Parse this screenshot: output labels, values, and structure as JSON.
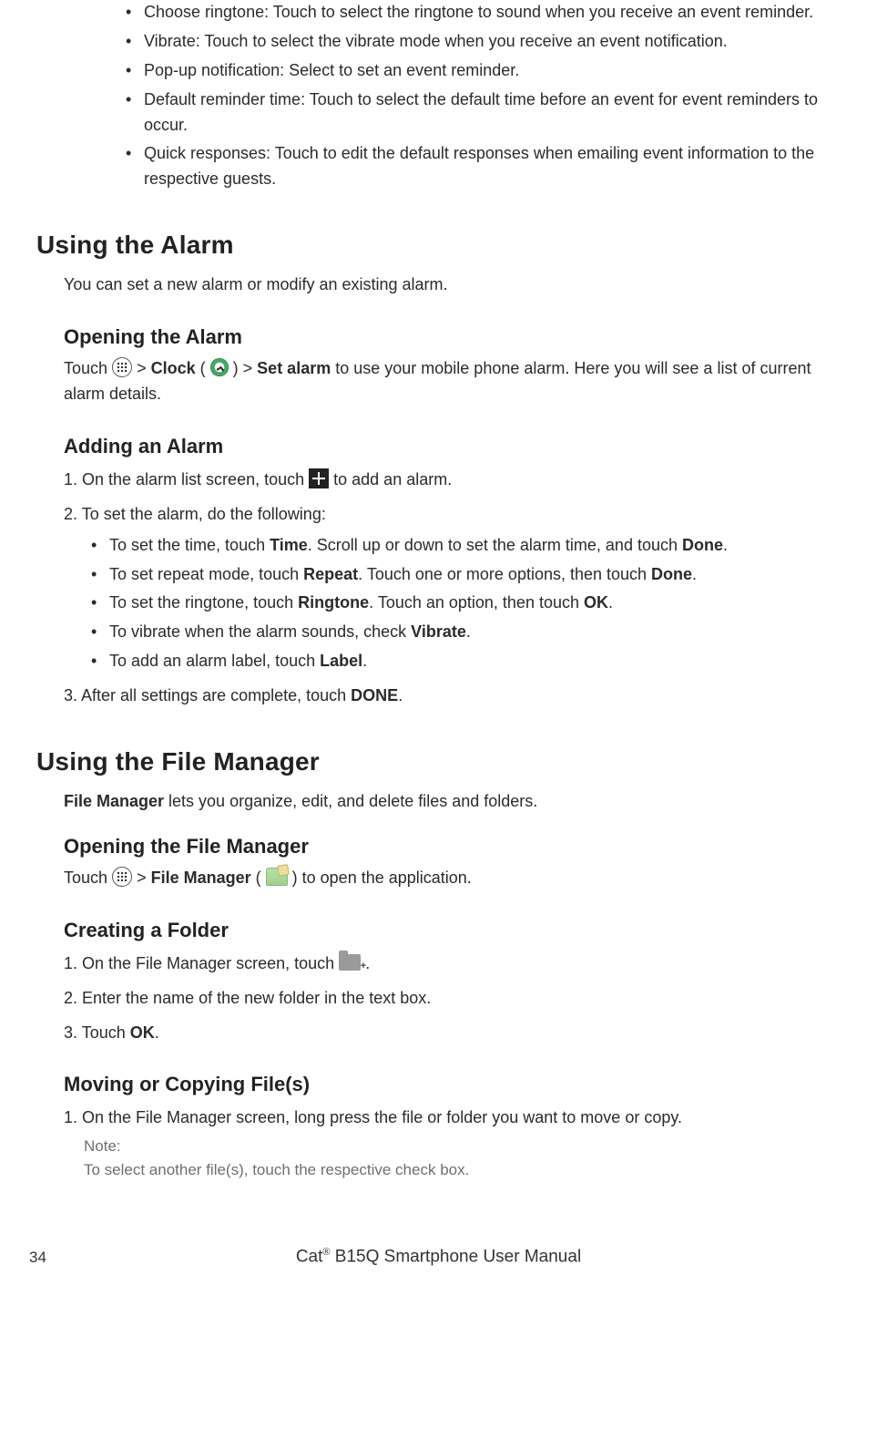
{
  "intro_bullets": [
    "Choose ringtone: Touch to select the ringtone to sound when you receive an event reminder.",
    "Vibrate: Touch to select the vibrate mode when you receive an event notification.",
    "Pop-up notification: Select to set an event reminder.",
    "Default reminder time: Touch to select the default time before an event for event reminders to occur.",
    "Quick responses: Touch to edit the default responses when emailing event information to the respective guests."
  ],
  "alarm": {
    "h1": "Using the Alarm",
    "intro": "You can set a new alarm or modify an existing alarm.",
    "open_h2": "Opening the Alarm",
    "open_pre": "Touch ",
    "open_gt1": " > ",
    "open_clock": "Clock",
    "open_paren_open": " (",
    "open_paren_close": ") > ",
    "open_setalarm": "Set alarm",
    "open_post": " to use your mobile phone alarm. Here you will see a list of current alarm details.",
    "add_h2": "Adding an Alarm",
    "step1_pre": "1. On the alarm list screen, touch ",
    "step1_post": " to add an alarm.",
    "step2": "2. To set the alarm, do the following:",
    "sub": {
      "time_pre": "To set the time, touch ",
      "time_b": "Time",
      "time_mid": ". Scroll up or down to set the alarm time, and touch ",
      "time_done": "Done",
      "time_post": ".",
      "repeat_pre": "To set repeat mode, touch ",
      "repeat_b": "Repeat",
      "repeat_mid": ". Touch one or more options, then touch ",
      "repeat_done": "Done",
      "repeat_post": ".",
      "ring_pre": "To set the ringtone, touch ",
      "ring_b": "Ringtone",
      "ring_mid": ". Touch an option, then touch ",
      "ring_ok": "OK",
      "ring_post": ".",
      "vib_pre": "To vibrate when the alarm sounds, check ",
      "vib_b": "Vibrate",
      "vib_post": ".",
      "lab_pre": "To add an alarm label, touch ",
      "lab_b": "Label",
      "lab_post": "."
    },
    "step3_pre": "3. After all settings are complete, touch ",
    "step3_b": "DONE",
    "step3_post": "."
  },
  "fm": {
    "h1": "Using the File Manager",
    "intro_b": "File Manager",
    "intro_post": " lets you organize, edit, and delete files and folders.",
    "open_h2": "Opening the File Manager",
    "open_pre": "Touch ",
    "open_gt": " > ",
    "open_b": "File Manager",
    "open_paren_open": " (",
    "open_paren_close": ") to open the application.",
    "create_h2": "Creating a Folder",
    "c1_pre": "1. On the File Manager screen, touch ",
    "c1_post": " .",
    "c2": "2. Enter the name of the new folder in the text box.",
    "c3_pre": "3. Touch ",
    "c3_b": "OK",
    "c3_post": ".",
    "move_h2": "Moving or Copying File(s)",
    "m1": "1. On the File Manager screen, long press the file or folder you want to move or copy.",
    "note_label": "Note:",
    "note_body": "To select another file(s), touch the respective check box."
  },
  "footer": {
    "page": "34",
    "title_pre": "Cat",
    "title_sup": "®",
    "title_post": " B15Q Smartphone User Manual"
  }
}
